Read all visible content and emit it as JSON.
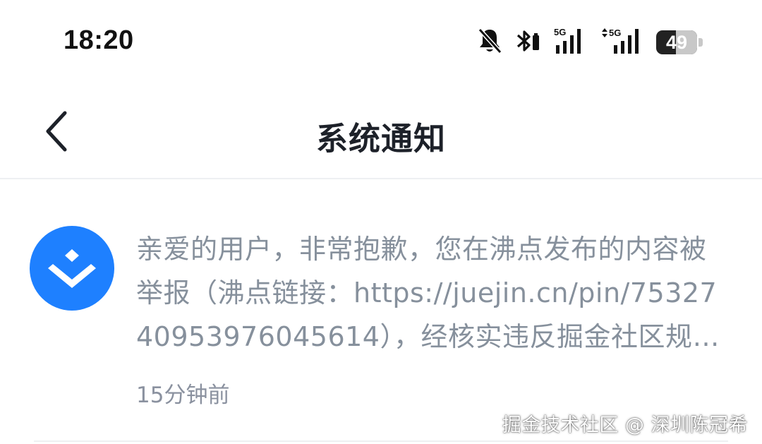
{
  "status_bar": {
    "time": "18:20",
    "icons": [
      "bell-muted-icon",
      "bluetooth-icon",
      "signal-5g-icon",
      "signal-5g-data-icon"
    ],
    "signal_label_1": "5G",
    "signal_label_2": "5G",
    "battery_level": "49",
    "battery_fraction": 0.49
  },
  "header": {
    "title": "系统通知",
    "back_icon": "chevron-left-icon"
  },
  "notification": {
    "avatar_icon": "juejin-logo-icon",
    "avatar_color": "#1e80ff",
    "message": "亲爱的用户，非常抱歉，您在沸点发布的内容被举报（沸点链接：https://juejin.cn/pin/7532740953976045614），经核实违反掘金社区规范，已被删除。",
    "time": "15分钟前",
    "text_color": "#86909c"
  },
  "watermark": "掘金技术社区 @ 深圳陈冠希"
}
